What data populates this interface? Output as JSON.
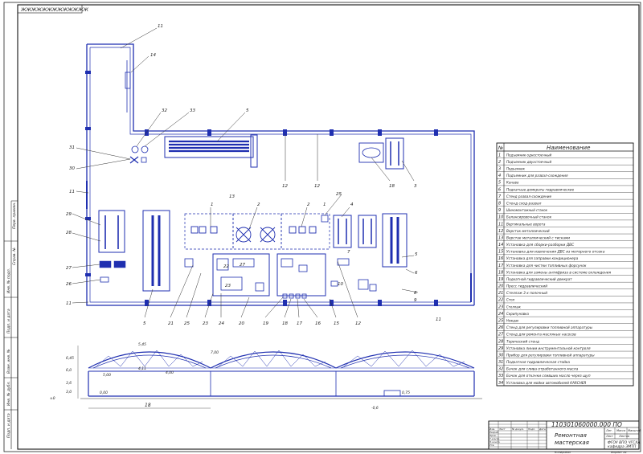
{
  "drawing": {
    "sheet_stamp": "ЖЖЖЖЖЖЖЖЖЖЖЖЖ",
    "side_labels": [
      "Подп. и дата",
      "Инв. № дубл.",
      "Взам. инв. №",
      "Подп. и дата",
      "Инв. № подл.",
      "Справ. №",
      "Перв. примен."
    ],
    "callouts": {
      "top": [
        "11",
        "14",
        "32",
        "33",
        "5",
        "12",
        "12",
        "18",
        "3"
      ],
      "left": [
        "31",
        "30",
        "11",
        "29",
        "28",
        "27",
        "26",
        "11"
      ],
      "middle": [
        "13",
        "2",
        "1",
        "25",
        "4",
        "2",
        "1",
        "7",
        "10",
        "8",
        "9",
        "5",
        "6",
        "11"
      ],
      "bottom": [
        "5",
        "21",
        "25",
        "23",
        "24",
        "20",
        "19",
        "18",
        "17",
        "16",
        "15",
        "12"
      ],
      "room": [
        "22",
        "23",
        "27"
      ]
    },
    "section": {
      "dims_left": [
        "6,45",
        "6,0",
        "3,6",
        "3,0",
        "±0"
      ],
      "dims_top": [
        "5,45",
        "7,00",
        "4,11",
        "4,00",
        "5,00"
      ],
      "dim_span": "18",
      "dim_right": "0,75",
      "dim_ground": "-0,6",
      "dim_level": "0,00"
    }
  },
  "spec": {
    "header": {
      "pos": "№",
      "name": "Наименование"
    },
    "rows": [
      {
        "n": "1",
        "t": "Подъемник одностоечный"
      },
      {
        "n": "2",
        "t": "Подъемник двухстоечный"
      },
      {
        "n": "3",
        "t": "Подъемник"
      },
      {
        "n": "4",
        "t": "Подъемник для развал-схождения"
      },
      {
        "n": "5",
        "t": "Канава"
      },
      {
        "n": "6",
        "t": "Подкатные домкраты гидравлические"
      },
      {
        "n": "7",
        "t": "Стенд развал-схождение"
      },
      {
        "n": "8",
        "t": "Стенд сход-развал"
      },
      {
        "n": "9",
        "t": "Шиномонтажный станок"
      },
      {
        "n": "10",
        "t": "Балансировочный станок"
      },
      {
        "n": "11",
        "t": "Вертикальные ворота"
      },
      {
        "n": "12",
        "t": "Верстак металлический"
      },
      {
        "n": "13",
        "t": "Верстак металлический с тисками"
      },
      {
        "n": "14",
        "t": "Установка для сборки-разборки ДВС"
      },
      {
        "n": "15",
        "t": "Установка для извлечения ДВС из моторного отсека"
      },
      {
        "n": "16",
        "t": "Установка для заправки кондиционера"
      },
      {
        "n": "17",
        "t": "Установка для чистки топливных форсунок"
      },
      {
        "n": "18",
        "t": "Установка для замены антифриза в системе охлаждения"
      },
      {
        "n": "19",
        "t": "Подкатной гидравлический домкрат"
      },
      {
        "n": "20",
        "t": "Пресс гидравлический"
      },
      {
        "n": "21",
        "t": "Стеллаж 3-х полочный"
      },
      {
        "n": "22",
        "t": "Стол"
      },
      {
        "n": "23",
        "t": "Стеллаж"
      },
      {
        "n": "24",
        "t": "Скрипуновка"
      },
      {
        "n": "25",
        "t": "Нождак"
      },
      {
        "n": "26",
        "t": "Стенд для регулировки топливной аппаратуры"
      },
      {
        "n": "27",
        "t": "Стенд для ремонта масляных насосов"
      },
      {
        "n": "28",
        "t": "Торический стенд"
      },
      {
        "n": "29",
        "t": "Установка линии инструментальной контроля"
      },
      {
        "n": "30",
        "t": "Прибор для регулировки топливной аппаратуры"
      },
      {
        "n": "31",
        "t": "Подкатная гидравлическая стойка"
      },
      {
        "n": "32",
        "t": "Бачок для слива отработанного масла"
      },
      {
        "n": "33",
        "t": "Бачок для откачки сливших масло через щуп"
      },
      {
        "n": "34",
        "t": "Установка для мойки автомобилей KARCHER"
      }
    ]
  },
  "title_block": {
    "code": "110301060000.000 ПО",
    "title_line1": "Ремонтная",
    "title_line2": "мастерская",
    "org_line1": "ФГОУ ВПО ЧГСХА",
    "org_line2": "кафедра ЭМТП",
    "stage_header": [
      "Лит.",
      "Масса",
      "Масштаб"
    ],
    "left_headers": [
      "Изм.",
      "Лист",
      "№ докум.",
      "Подп.",
      "Дата"
    ],
    "left_rows": [
      "Разраб.",
      "Пров.",
      "Т.контр.",
      "Н.контр.",
      "Утв."
    ],
    "sheet_row": [
      "Лист",
      "Листов"
    ],
    "footer_left": "Копировал",
    "footer_right": "Формат А1"
  }
}
